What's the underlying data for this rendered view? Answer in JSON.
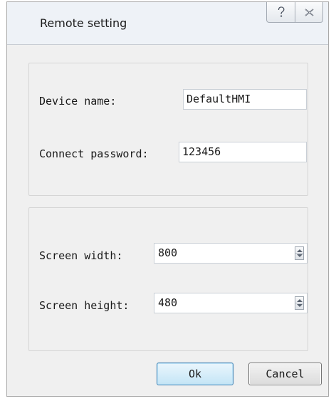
{
  "window": {
    "title": "Remote setting",
    "help_icon": "question-mark-icon",
    "close_icon": "close-x-icon"
  },
  "device_group": {
    "device_name_label": "Device name:",
    "device_name_value": "DefaultHMI",
    "password_label": "Connect password:",
    "password_value": "123456"
  },
  "screen_group": {
    "width_label": "Screen width:",
    "width_value": "800",
    "height_label": "Screen height:",
    "height_value": "480"
  },
  "buttons": {
    "ok_label": "Ok",
    "cancel_label": "Cancel"
  },
  "colors": {
    "window_bg": "#f0f0f0",
    "ok_border": "#3c7fb1"
  }
}
